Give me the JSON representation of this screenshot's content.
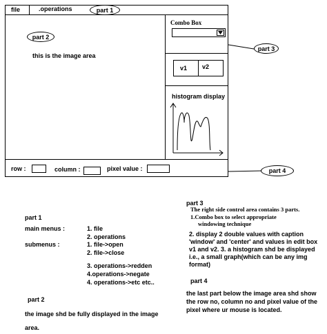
{
  "menubar": {
    "file_label": "file",
    "operations_label": ".operations"
  },
  "callouts": {
    "part1": "part 1",
    "part2": "part 2",
    "part3": "part 3",
    "part4": "part 4"
  },
  "image_area": {
    "caption": "this is the image area"
  },
  "controls": {
    "combo_label": "Combo Box",
    "combo_value": "",
    "v1_label": "v1",
    "v2_label": "v2",
    "histogram_label": "histogram display"
  },
  "statusbar": {
    "row_label": "row :",
    "column_label": "column :",
    "pixel_label": "pixel value :"
  },
  "notes_left": {
    "part1_heading": "part 1",
    "main_menus_label": "main menus :",
    "submenus_label": "submenus :",
    "menu_items": [
      "1. file",
      "2. operations"
    ],
    "submenu_items": [
      "1. file->open",
      "2. file->close",
      "3. operations->redden",
      "4.operations->negate",
      "4. operations->etc etc.."
    ],
    "part2_heading": "part 2",
    "part2_text_1": "the image shd be fully displayed in the image",
    "part2_text_2": "area."
  },
  "notes_right": {
    "part3_heading": "part 3",
    "part3_intro": "The right side control area contains 3 parts.",
    "part3_item1_line1": "1.Combo box to select appropriate",
    "part3_item1_line2": "windowing technique",
    "part3_item2_lines": [
      "2. display 2 double values with caption",
      "'window' and 'center' and values in edit box",
      "v1 and v2. 3. a histogram shd be displayed",
      "i.e., a small graph(which can be any img",
      "format)"
    ],
    "part4_heading": "part 4",
    "part4_lines": [
      "the last part below the image area shd show",
      "the row no, column no and pixel value of the",
      "pixel where ur mouse is located."
    ]
  }
}
